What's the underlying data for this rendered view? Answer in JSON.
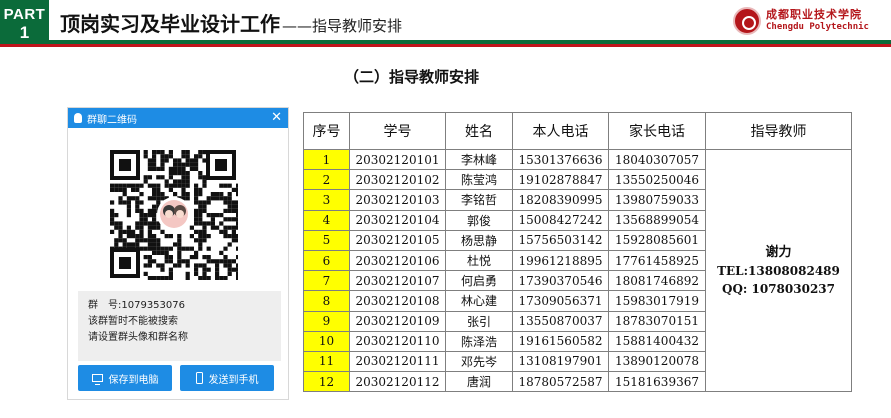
{
  "header": {
    "part_label": "PART",
    "part_number": "1",
    "title": "顶岗实习及毕业设计工作",
    "subtitle": "——指导教师安排",
    "logo_cn": "成都职业技术学院",
    "logo_en": "Chengdu Polytechnic",
    "colors": {
      "green": "#0b6b3a",
      "red": "#c0141c"
    }
  },
  "section_title": "（二）指导教师安排",
  "qr_panel": {
    "title": "群聊二维码",
    "title_icon": "bell-icon",
    "close_icon": "close-icon",
    "group_number": "群　号:1079353076",
    "line1": "该群暂时不能被搜索",
    "line2": "请设置群头像和群名称",
    "save_button": "保存到电脑",
    "send_button": "发送到手机",
    "accent_color": "#1e8ce4"
  },
  "table": {
    "headers": [
      "序号",
      "学号",
      "姓名",
      "本人电话",
      "家长电话",
      "指导教师"
    ],
    "rows": [
      [
        "1",
        "20302120101",
        "李林峰",
        "15301376636",
        "18040307057"
      ],
      [
        "2",
        "20302120102",
        "陈莹鸿",
        "19102878847",
        "13550250046"
      ],
      [
        "3",
        "20302120103",
        "李铭哲",
        "18208390995",
        "13980759033"
      ],
      [
        "4",
        "20302120104",
        "郭俊",
        "15008427242",
        "13568899054"
      ],
      [
        "5",
        "20302120105",
        "杨思静",
        "15756503142",
        "15928085601"
      ],
      [
        "6",
        "20302120106",
        "杜悦",
        "19961218895",
        "17761458925"
      ],
      [
        "7",
        "20302120107",
        "何启勇",
        "17390370546",
        "18081746892"
      ],
      [
        "8",
        "20302120108",
        "林心建",
        "17309056371",
        "15983017919"
      ],
      [
        "9",
        "20302120109",
        "张引",
        "13550870037",
        "18783070151"
      ],
      [
        "10",
        "20302120110",
        "陈泽浩",
        "19161560582",
        "15881400432"
      ],
      [
        "11",
        "20302120111",
        "邓先岑",
        "13108197901",
        "13890120078"
      ],
      [
        "12",
        "20302120112",
        "唐润",
        "18780572587",
        "15181639367"
      ]
    ],
    "advisor": {
      "name": "谢力",
      "tel": "TEL:13808082489",
      "qq": "QQ: 1078030237"
    },
    "highlight_color": "#ffff00"
  }
}
